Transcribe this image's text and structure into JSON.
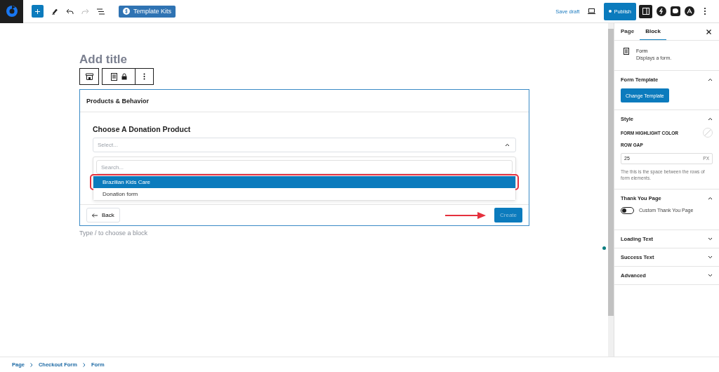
{
  "topbar": {
    "template_kits": "Template Kits",
    "save_draft": "Save draft",
    "publish": "Publish"
  },
  "editor": {
    "title_placeholder": "Add title",
    "form": {
      "header": "Products & Behavior",
      "label": "Choose A Donation Product",
      "select_placeholder": "Select...",
      "expanded": true,
      "search_placeholder": "Search...",
      "options": [
        {
          "label": "Brazilian Kids Care",
          "selected": true
        },
        {
          "label": "Donation form",
          "selected": false
        }
      ],
      "back": "Back",
      "create": "Create",
      "create_disabled": true
    },
    "block_hint": "Type / to choose a block"
  },
  "sidebar": {
    "tabs": [
      {
        "label": "Page",
        "selected": false
      },
      {
        "label": "Block",
        "selected": true
      }
    ],
    "block": {
      "name": "Form",
      "description": "Displays a form."
    },
    "sections": [
      {
        "kind": "button",
        "title": "Form Template",
        "expanded": true,
        "button": "Change Template"
      },
      {
        "kind": "style",
        "title": "Style",
        "expanded": true,
        "color_label": "FORM HIGHLIGHT COLOR",
        "gap_label": "ROW GAP",
        "gap_value": "25",
        "unit": "PX",
        "help": "The this is the space between the rows of form elements."
      },
      {
        "kind": "toggle",
        "title": "Thank You Page",
        "expanded": true,
        "toggle_label": "Custom Thank You Page",
        "on": false
      },
      {
        "kind": "plain",
        "title": "Loading Text",
        "expanded": false
      },
      {
        "kind": "plain",
        "title": "Success Text",
        "expanded": false
      },
      {
        "kind": "plain",
        "title": "Advanced",
        "expanded": false
      }
    ]
  },
  "breadcrumb": [
    "Page",
    "Checkout Form",
    "Form"
  ]
}
